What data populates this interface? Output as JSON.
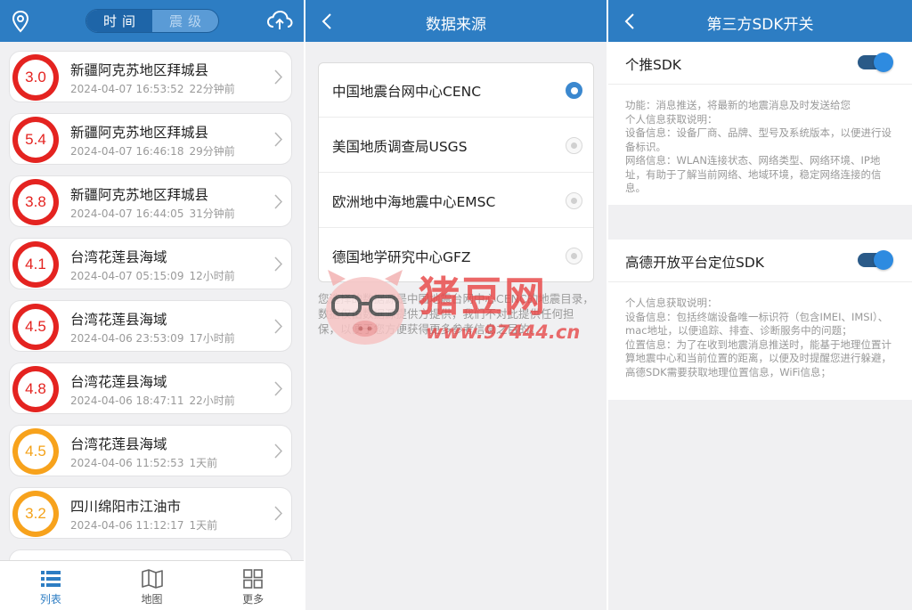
{
  "panel1": {
    "segment": {
      "left": "时间",
      "right": "震级"
    },
    "quakes": [
      {
        "mag": "3.0",
        "level": "red",
        "place": "新疆阿克苏地区拜城县",
        "time": "2024-04-07 16:53:52",
        "ago": "22分钟前"
      },
      {
        "mag": "5.4",
        "level": "red",
        "place": "新疆阿克苏地区拜城县",
        "time": "2024-04-07 16:46:18",
        "ago": "29分钟前"
      },
      {
        "mag": "3.8",
        "level": "red",
        "place": "新疆阿克苏地区拜城县",
        "time": "2024-04-07 16:44:05",
        "ago": "31分钟前"
      },
      {
        "mag": "4.1",
        "level": "red",
        "place": "台湾花莲县海域",
        "time": "2024-04-07 05:15:09",
        "ago": "12小时前"
      },
      {
        "mag": "4.5",
        "level": "red",
        "place": "台湾花莲县海域",
        "time": "2024-04-06 23:53:09",
        "ago": "17小时前"
      },
      {
        "mag": "4.8",
        "level": "red",
        "place": "台湾花莲县海域",
        "time": "2024-04-06 18:47:11",
        "ago": "22小时前"
      },
      {
        "mag": "4.5",
        "level": "orange",
        "place": "台湾花莲县海域",
        "time": "2024-04-06 11:52:53",
        "ago": "1天前"
      },
      {
        "mag": "3.2",
        "level": "orange",
        "place": "四川绵阳市江油市",
        "time": "2024-04-06 11:12:17",
        "ago": "1天前"
      }
    ],
    "tabs": [
      {
        "label": "列表",
        "icon": "list-icon",
        "active": true
      },
      {
        "label": "地图",
        "icon": "map-icon",
        "active": false
      },
      {
        "label": "更多",
        "icon": "grid-icon",
        "active": false
      }
    ]
  },
  "panel2": {
    "title": "数据来源",
    "sources": [
      {
        "label": "中国地震台网中心CENC",
        "selected": true
      },
      {
        "label": "美国地质调查局USGS",
        "selected": false
      },
      {
        "label": "欧洲地中海地震中心EMSC",
        "selected": false
      },
      {
        "label": "德国地学研究中心GFZ",
        "selected": false
      }
    ],
    "note": "您选择的数据源是中国地震台网中心CENC的地震目录，数据仅由数据源提供方提供，我们不对此提供任何担保，以便于您方便获得更多参考信息之目的。"
  },
  "panel3": {
    "title": "第三方SDK开关",
    "sections": [
      {
        "title": "个推SDK",
        "enabled": true,
        "body": [
          "功能：消息推送，将最新的地震消息及时发送给您",
          "个人信息获取说明：",
          "设备信息：设备厂商、品牌、型号及系统版本，以便进行设备标识。",
          "网络信息：WLAN连接状态、网络类型、网络环境、IP地址，有助于了解当前网络、地域环境，稳定网络连接的信息。"
        ]
      },
      {
        "title": "高德开放平台定位SDK",
        "enabled": true,
        "body": [
          "个人信息获取说明：",
          "设备信息：包括终端设备唯一标识符（包含IMEI、IMSI）、mac地址，以便追踪、排查、诊断服务中的问题；",
          "位置信息：为了在收到地震消息推送时，能基于地理位置计算地震中心和当前位置的距离，以便及时提醒您进行躲避，高德SDK需要获取地理位置信息，WiFi信息；"
        ]
      }
    ]
  },
  "watermark": {
    "text": "猪豆网",
    "url": "www.97444.cn"
  },
  "colors": {
    "header": "#2d7dc3",
    "mag_red": "#e42320",
    "mag_orange": "#f7a21c"
  }
}
